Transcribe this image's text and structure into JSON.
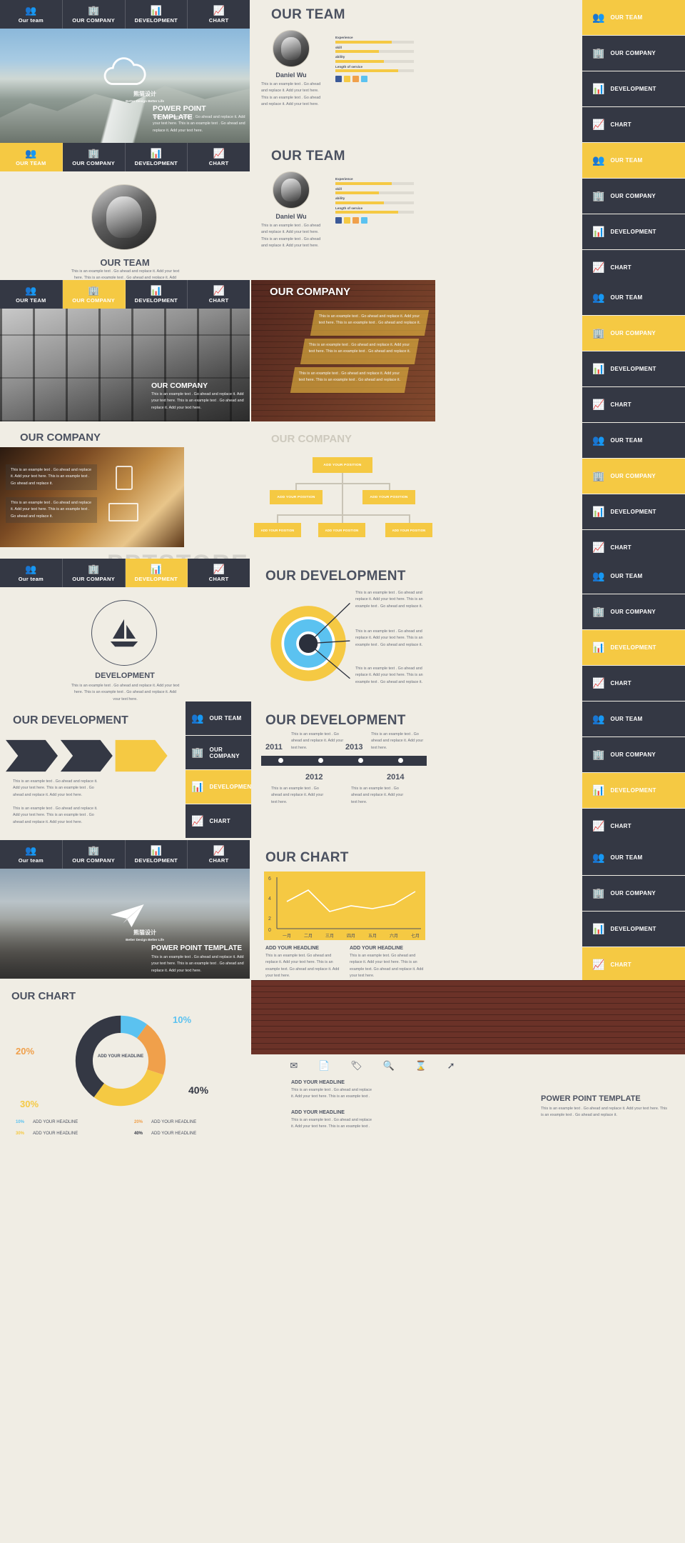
{
  "brand": {
    "logo_cn": "熊猫设计",
    "logo_tagline": "Better Design Better Life",
    "accent": "#F5C943",
    "dark": "#343844",
    "bg": "#F0EDE4",
    "blue": "#5BC2F0",
    "orange": "#F0A04B"
  },
  "nav": {
    "items": [
      {
        "label": "Our  team",
        "icon": "team-icon",
        "glyph": "👥"
      },
      {
        "label": "OUR COMPANY",
        "icon": "building-icon",
        "glyph": "🏢"
      },
      {
        "label": "DEVELOPMENT",
        "icon": "presentation-icon",
        "glyph": "📊"
      },
      {
        "label": "CHART",
        "icon": "chart-icon",
        "glyph": "📈"
      }
    ]
  },
  "rail": {
    "items": [
      {
        "label": "OUR TEAM",
        "glyph": "👥"
      },
      {
        "label": "OUR COMPANY",
        "glyph": "🏢"
      },
      {
        "label": "DEVELOPMENT",
        "glyph": "📊"
      },
      {
        "label": "CHART",
        "glyph": "📈"
      }
    ]
  },
  "body_text": "This is an example text . Go ahead and replace it.  Add your text here. This is an example text . Go ahead and replace it. Add your text here.",
  "body_text_short": "This is an example text . Go ahead and replace it. Add your text here. This is an example text . Go ahead and replace it.",
  "slides": {
    "cover": {
      "title": "POWER POINT TEMPLATE",
      "body": "This is an example text . Go ahead and replace it.  Add your text here. This is an example text . Go ahead and replace it. Add your text here."
    },
    "cover2": {
      "title": "POWER POINT TEMPLATE",
      "body": "This is an example text . Go ahead and replace it.  Add your text here. This is an example text . Go ahead and replace it. Add your text here."
    },
    "team_section": {
      "title": "OUR TEAM",
      "body": "This is an example text . Go ahead and replace it.  Add your text here. This is an example text . Go ahead and replace it. Add your text here."
    },
    "team_a": {
      "title": "OUR TEAM",
      "name": "Daniel Wu",
      "body": "This is an example text . Go ahead and replace it. Add your text here. This is an example text . Go ahead and replace it. Add your text here.",
      "skills": [
        {
          "label": "Experience",
          "value": 72
        },
        {
          "label": "skill",
          "value": 55
        },
        {
          "label": "ability",
          "value": 62
        },
        {
          "label": "Length of service",
          "value": 80
        }
      ],
      "social": [
        "facebook",
        "twitter",
        "rss",
        "mail"
      ]
    },
    "team_b": {
      "title": "OUR TEAM",
      "name": "Daniel Wu",
      "body": "This is an example text . Go ahead and replace it. Add your text here. This is an example text . Go ahead and replace it. Add your text here.",
      "skills": [
        {
          "label": "Experience",
          "value": 72
        },
        {
          "label": "skill",
          "value": 55
        },
        {
          "label": "ability",
          "value": 62
        },
        {
          "label": "Length of service",
          "value": 80
        }
      ]
    },
    "company_photo": {
      "title": "OUR COMPANY",
      "body": "This is an example text . Go ahead and replace it.  Add your text here. This is an example text . Go ahead and replace it. Add your text here."
    },
    "company_brick": {
      "title": "OUR COMPANY",
      "cards": [
        "This is an example text . Go ahead and replace it. Add your text here. This is an example text . Go ahead and replace it.",
        "This is an example text . Go ahead and replace it. Add your text here. This is an example text . Go ahead and replace it.",
        "This is an example text . Go ahead and replace it. Add your text here. This is an example text . Go ahead and replace it."
      ]
    },
    "company_desk": {
      "title": "OUR COMPANY",
      "cards": [
        "This is an example text . Go ahead and replace it. Add your text here. This is an example text . Go ahead and replace it.",
        "This is an example text . Go ahead and replace it. Add your text here. This is an example text . Go ahead and replace it."
      ]
    },
    "org_chart": {
      "title": "OUR COMPANY",
      "nodes": [
        "ADD YOUR POSITION",
        "ADD YOUR POSITION",
        "ADD YOUR POSITION",
        "ADD YOUR POSITION",
        "ADD YOUR POSITION",
        "ADD YOUR POSITION"
      ]
    },
    "development_section": {
      "title": "DEVELOPMENT",
      "body": "This is an example text . Go ahead and replace it.  Add your text here. This is an example text . Go ahead and replace it. Add your text here."
    },
    "development_rings": {
      "title": "OUR DEVELOPMENT",
      "callouts": [
        "This is an example text . Go ahead and replace it. Add your text here. This is an example text . Go ahead and replace it.",
        "This is an example text . Go ahead and replace it. Add your text here. This is an example text . Go ahead and replace it.",
        "This is an example text . Go ahead and replace it. Add your text here. This is an example text . Go ahead and replace it."
      ]
    },
    "development_arrows": {
      "title": "OUR DEVELOPMENT",
      "paras": [
        "This is an example text . Go ahead and replace it. Add your text here. This is an example text . Go ahead and replace it. Add your text here.",
        "This is an example text . Go ahead and replace it. Add your text here. This is an example text . Go ahead and replace it. Add your text here."
      ]
    },
    "development_timeline": {
      "title": "OUR DEVELOPMENT",
      "years": [
        "2011",
        "2012",
        "2013",
        "2014"
      ],
      "notes": [
        "This is an example text . Go ahead and replace it. Add your text here.",
        "This is an example text . Go ahead and replace it. Add your text here.",
        "This is an example text . Go ahead and replace it. Add your text here.",
        "This is an example text . Go ahead and replace it. Add your text here."
      ]
    },
    "chart_line_slide": {
      "title": "OUR CHART",
      "headlines": [
        "ADD YOUR HEADLINE",
        "ADD YOUR HEADLINE"
      ],
      "bodies": [
        "This is an example text. Go ahead and replace it. Add your text here. This is an example text. Go ahead and replace it. Add your text here.",
        "This is an example text. Go ahead and replace it. Add your text here. This is an example text. Go ahead and replace it. Add your text here."
      ]
    },
    "chart_donut_slide": {
      "title": "OUR CHART",
      "center_label": "ADD YOUR HEADLINE",
      "legend": [
        {
          "pct": "10%",
          "label": "ADD YOUR HEADLINE"
        },
        {
          "pct": "20%",
          "label": "ADD YOUR HEADLINE"
        },
        {
          "pct": "30%",
          "label": "ADD YOUR HEADLINE"
        },
        {
          "pct": "40%",
          "label": "ADD YOUR HEADLINE"
        }
      ]
    },
    "thankyou": {
      "headline1": "ADD YOUR HEADLINE",
      "headline2": "ADD YOUR HEADLINE",
      "title": "POWER POINT TEMPLATE",
      "body1": "This is an example text . Go ahead and replace it. Add your text here. This is an example text .",
      "body2": "This is an example text . Go ahead and replace it. Add your text here. This is an example text .",
      "body3": "This is an example text . Go ahead and replace it. Add your text here. This is an example text . Go ahead and replace it.",
      "icons": [
        "mail-icon",
        "card-icon",
        "tag-icon",
        "search-icon",
        "hourglass-icon",
        "rocket-icon"
      ]
    }
  },
  "watermark": "PPTSTORE",
  "chart_data": [
    {
      "type": "line",
      "title": "OUR CHART",
      "categories": [
        "一月",
        "二月",
        "三月",
        "四月",
        "五月",
        "六月",
        "七月"
      ],
      "values": [
        3.1,
        4.2,
        2.4,
        2.9,
        2.7,
        3.0,
        4.1
      ],
      "ylim": [
        0,
        6
      ],
      "yticks": [
        0,
        2,
        4,
        6
      ],
      "xlabel": "",
      "ylabel": "",
      "grid": false,
      "line_color": "#FFFFFF",
      "plot_bg": "#F5C943"
    },
    {
      "type": "pie",
      "title": "OUR CHART",
      "labels": [
        "ADD YOUR HEADLINE",
        "ADD YOUR HEADLINE",
        "ADD YOUR HEADLINE",
        "ADD YOUR HEADLINE"
      ],
      "values": [
        10,
        20,
        30,
        40
      ],
      "value_labels": [
        "10%",
        "20%",
        "30%",
        "40%"
      ],
      "colors": [
        "#5BC2F0",
        "#F0A04B",
        "#F5C943",
        "#343844"
      ],
      "center_label": "ADD YOUR HEADLINE",
      "donut": true
    }
  ]
}
